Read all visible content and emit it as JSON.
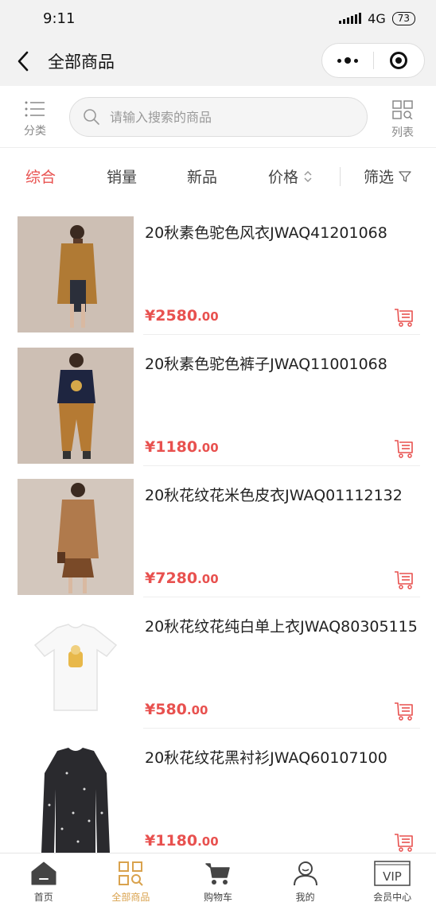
{
  "status_bar": {
    "time": "9:11",
    "network": "4G",
    "battery": "73"
  },
  "header": {
    "title": "全部商品"
  },
  "search": {
    "category_label": "分类",
    "placeholder": "请输入搜索的商品",
    "list_label": "列表"
  },
  "filters": {
    "tabs": [
      {
        "label": "综合",
        "active": true
      },
      {
        "label": "销量"
      },
      {
        "label": "新品"
      },
      {
        "label": "价格"
      },
      {
        "label": "筛选"
      }
    ]
  },
  "products": [
    {
      "name": "20秋素色驼色风衣JWAQ41201068",
      "price_int": "¥2580",
      "price_dec": ".00"
    },
    {
      "name": "20秋素色驼色裤子JWAQ11001068",
      "price_int": "¥1180",
      "price_dec": ".00"
    },
    {
      "name": "20秋花纹花米色皮衣JWAQ01112132",
      "price_int": "¥7280",
      "price_dec": ".00"
    },
    {
      "name": "20秋花纹花纯白单上衣JWAQ80305115",
      "price_int": "¥580",
      "price_dec": ".00"
    },
    {
      "name": "20秋花纹花黑衬衫JWAQ60107100",
      "price_int": "¥1180",
      "price_dec": ".00"
    }
  ],
  "bottom_nav": {
    "items": [
      {
        "label": "首页",
        "icon": "home-icon"
      },
      {
        "label": "全部商品",
        "icon": "grid-search-icon",
        "active": true
      },
      {
        "label": "购物车",
        "icon": "cart-icon"
      },
      {
        "label": "我的",
        "icon": "user-icon"
      },
      {
        "label": "会员中心",
        "icon": "vip-icon"
      }
    ]
  },
  "colors": {
    "accent": "#e8514f",
    "nav_active": "#d9a24d",
    "header_bg": "#f2f2f2"
  }
}
